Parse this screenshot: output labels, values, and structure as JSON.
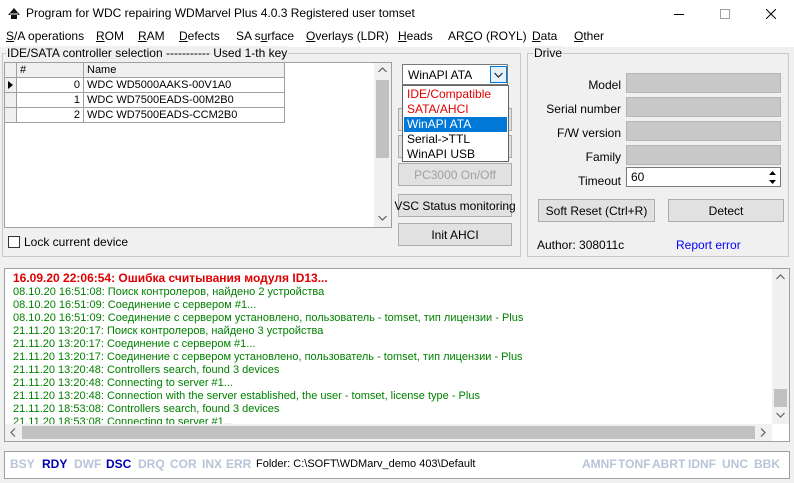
{
  "window": {
    "title": "Program for WDC repairing WDMarvel Plus 4.0.3 Registered user tomset"
  },
  "menu": [
    {
      "mnemonic": "S",
      "rest": "/A operations"
    },
    {
      "mnemonic": "R",
      "rest": "OM"
    },
    {
      "mnemonic": "R",
      "rest": "AM"
    },
    {
      "mnemonic": "D",
      "rest": "efects"
    },
    {
      "pre": "SA s",
      "mnemonic": "u",
      "rest": "rface"
    },
    {
      "mnemonic": "O",
      "rest": "verlays (LDR)"
    },
    {
      "mnemonic": "H",
      "rest": "eads"
    },
    {
      "pre": "AR",
      "mnemonic": "C",
      "rest": "O (ROYL)"
    },
    {
      "mnemonic": "D",
      "rest": "ata"
    },
    {
      "mnemonic": "O",
      "rest": "ther"
    }
  ],
  "controller": {
    "group_title": "IDE/SATA controller selection ----------- Used 1-th key",
    "columns": [
      "#",
      "Name"
    ],
    "rows": [
      {
        "num": "0",
        "name": "WDC WD5000AAKS-00V1A0"
      },
      {
        "num": "1",
        "name": "WDC WD7500EADS-00M2B0"
      },
      {
        "num": "2",
        "name": "WDC WD7500EADS-CCM2B0"
      }
    ],
    "lock_label": "Lock current device",
    "mode_selected": "WinAPI ATA",
    "mode_options": [
      "IDE/Compatible",
      "SATA/AHCI",
      "WinAPI ATA",
      "Serial->TTL",
      "WinAPI USB"
    ],
    "pc3000_label": "PC3000 On/Off",
    "vsc_label": "VSC Status monitoring",
    "init_ahci_label": "Init AHCI"
  },
  "drive": {
    "group_title": "Drive",
    "labels": {
      "model": "Model",
      "serial": "Serial number",
      "fw": "F/W version",
      "family": "Family",
      "timeout": "Timeout"
    },
    "timeout_value": "60",
    "soft_reset_label": "Soft Reset (Ctrl+R)",
    "detect_label": "Detect",
    "author": "Author: 308011c",
    "report_error": "Report error"
  },
  "log": [
    {
      "text": "16.09.20 22:06:54: Ошибка считывания модуля ID13...",
      "kind": "error"
    },
    {
      "text": "08.10.20 16:51:08: Поиск контролеров, найдено 2 устройства",
      "kind": "ok"
    },
    {
      "text": "08.10.20 16:51:09: Соединение с сервером #1...",
      "kind": "ok"
    },
    {
      "text": "08.10.20 16:51:09: Соединение с сервером установлено, пользователь - tomset, тип лицензии - Plus",
      "kind": "ok"
    },
    {
      "text": "21.11.20 13:20:17: Поиск контролеров, найдено 3 устройства",
      "kind": "ok"
    },
    {
      "text": "21.11.20 13:20:17: Соединение с сервером #1...",
      "kind": "ok"
    },
    {
      "text": "21.11.20 13:20:17: Соединение с сервером установлено, пользователь - tomset, тип лицензии - Plus",
      "kind": "ok"
    },
    {
      "text": "21.11.20 13:20:48: Controllers search, found 3 devices",
      "kind": "ok"
    },
    {
      "text": "21.11.20 13:20:48: Connecting to server #1...",
      "kind": "ok"
    },
    {
      "text": "21.11.20 13:20:48: Connection with the server established, the user - tomset, license type - Plus",
      "kind": "ok"
    },
    {
      "text": "21.11.20 18:53:08: Controllers search, found 3 devices",
      "kind": "ok"
    },
    {
      "text": "21.11.20 18:53:08: Connecting to server #1...",
      "kind": "ok"
    }
  ],
  "status": {
    "left_flags": [
      {
        "text": "BSY",
        "active": false
      },
      {
        "text": "RDY",
        "active": true
      },
      {
        "text": "DWF",
        "active": false
      },
      {
        "text": "DSC",
        "active": true
      },
      {
        "text": "DRQ",
        "active": false
      },
      {
        "text": "COR",
        "active": false
      },
      {
        "text": "INX",
        "active": false
      },
      {
        "text": "ERR",
        "active": false
      }
    ],
    "folder": "Folder: C:\\SOFT\\WDMarv_demo 403\\Default",
    "right_flags": [
      "AMNF",
      "TONF",
      "ABRT",
      "IDNF",
      "UNC",
      "BBK"
    ]
  },
  "colors": {
    "selection": "#0078d7",
    "error_text": "#e00000",
    "ok_text": "#008000",
    "link": "#0000ff",
    "flag_active": "#0000b0",
    "flag_inactive": "#b8c4d8",
    "option_red": "#e00000"
  }
}
